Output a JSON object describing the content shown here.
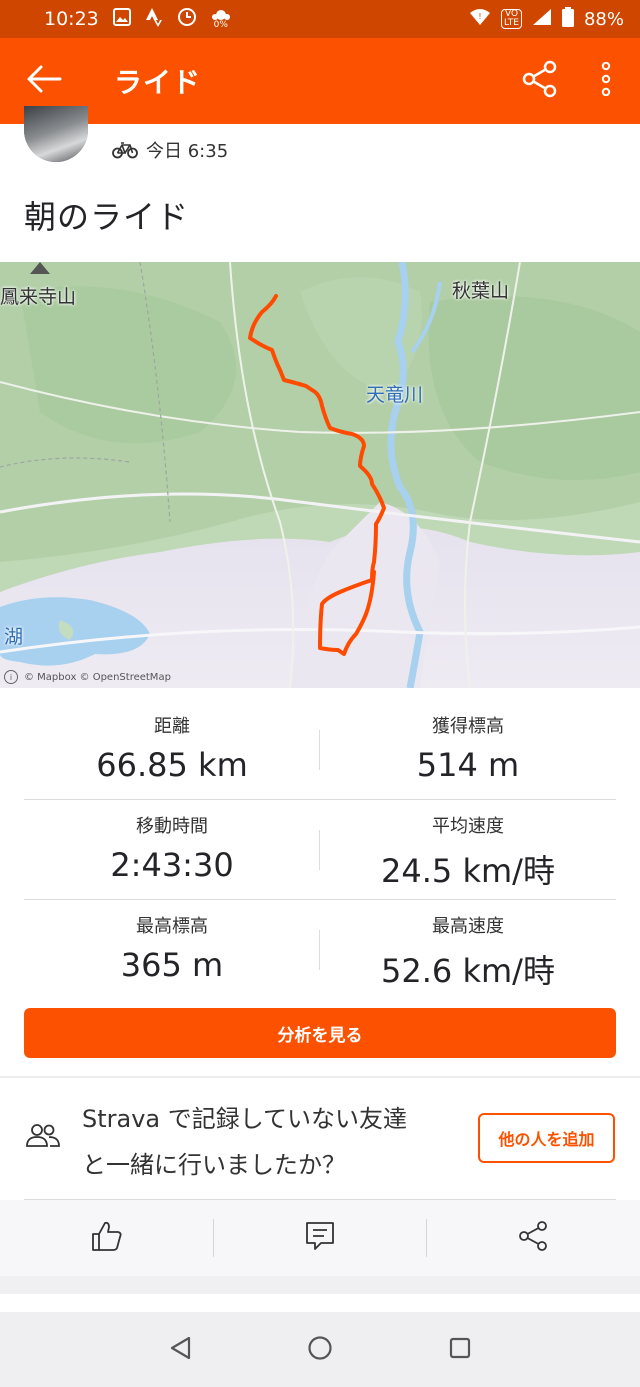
{
  "status_bar": {
    "time": "10:23",
    "data_rate": "0%",
    "network_badge_top": "VO",
    "network_badge_bottom": "LTE",
    "battery": "88%"
  },
  "app_bar": {
    "title": "ライド",
    "back_icon": "arrow-left-icon",
    "share_icon": "share-icon",
    "more_icon": "more-vertical-icon"
  },
  "activity": {
    "type_icon": "bike-icon",
    "date_time": "今日 6:35",
    "title": "朝のライド"
  },
  "map": {
    "labels": {
      "place1": "鳳来寺山",
      "place2": "秋葉山",
      "river": "天竜川",
      "lake": "湖"
    },
    "attribution": "© Mapbox © OpenStreetMap"
  },
  "stats": [
    {
      "left": {
        "label": "距離",
        "value": "66.85 km"
      },
      "right": {
        "label": "獲得標高",
        "value": "514 m"
      }
    },
    {
      "left": {
        "label": "移動時間",
        "value": "2:43:30"
      },
      "right": {
        "label": "平均速度",
        "value": "24.5 km/時"
      }
    },
    {
      "left": {
        "label": "最高標高",
        "value": "365 m"
      },
      "right": {
        "label": "最高速度",
        "value": "52.6 km/時"
      }
    }
  ],
  "analyze_button": "分析を見る",
  "friends_prompt": {
    "line1": "Strava で記録していない友達",
    "line2": "と一緒に行いましたか？",
    "add_button": "他の人を追加"
  },
  "actions": {
    "kudos_icon": "thumbs-up-icon",
    "comment_icon": "comment-icon",
    "share_icon": "share-icon"
  },
  "colors": {
    "brand": "#fc5200",
    "status_bar": "#cf4600",
    "route": "#ff4b00"
  }
}
